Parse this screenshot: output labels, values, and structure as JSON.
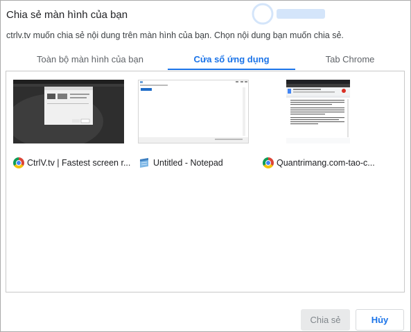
{
  "dialog": {
    "title": "Chia sẻ màn hình của bạn",
    "subtitle": "ctrlv.tv muốn chia sẻ nội dung trên màn hình của bạn. Chọn nội dung bạn muốn chia sẻ."
  },
  "tabs": [
    {
      "label": "Toàn bộ màn hình của bạn",
      "active": false
    },
    {
      "label": "Cửa sổ ứng dụng",
      "active": true
    },
    {
      "label": "Tab Chrome",
      "active": false
    }
  ],
  "windows": [
    {
      "title": "CtrlV.tv | Fastest screen r...",
      "icon": "chrome-icon"
    },
    {
      "title": "Untitled - Notepad",
      "icon": "notepad-icon"
    },
    {
      "title": "Quantrimang.com-tao-c...",
      "icon": "chrome-icon"
    }
  ],
  "buttons": {
    "share_label": "Chia sẻ",
    "cancel_label": "Hủy"
  },
  "colors": {
    "accent": "#1a73e8",
    "disabled_bg": "#e8e9ea",
    "text": "#202124"
  }
}
